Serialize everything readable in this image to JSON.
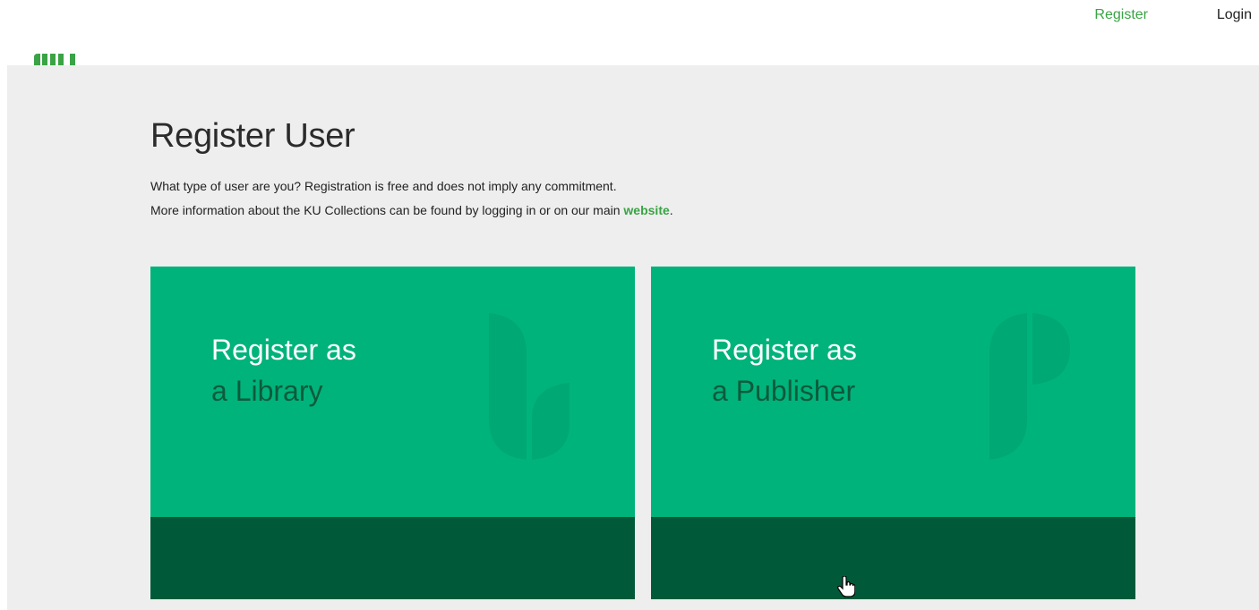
{
  "topnav": {
    "register_label": "Register",
    "login_label": "Login"
  },
  "logo": {
    "icon": "ku-logo-icon",
    "color": "#3aa345"
  },
  "main": {
    "title": "Register User",
    "intro_line1": "What type of user are you? Registration is free and does not imply any commitment.",
    "intro_line2_prefix": "More information about the KU Collections can be found by logging in or on our main ",
    "intro_link": "website",
    "intro_line2_suffix": "."
  },
  "cards": {
    "library": {
      "line1": "Register as",
      "line2": "a Library",
      "icon": "library-l-icon"
    },
    "publisher": {
      "line1": "Register as",
      "line2": "a Publisher",
      "icon": "publisher-p-icon"
    }
  },
  "colors": {
    "accent": "#3aa345",
    "card_green": "#00b37b",
    "card_dark": "#005a3a",
    "background": "#eeeeee"
  }
}
